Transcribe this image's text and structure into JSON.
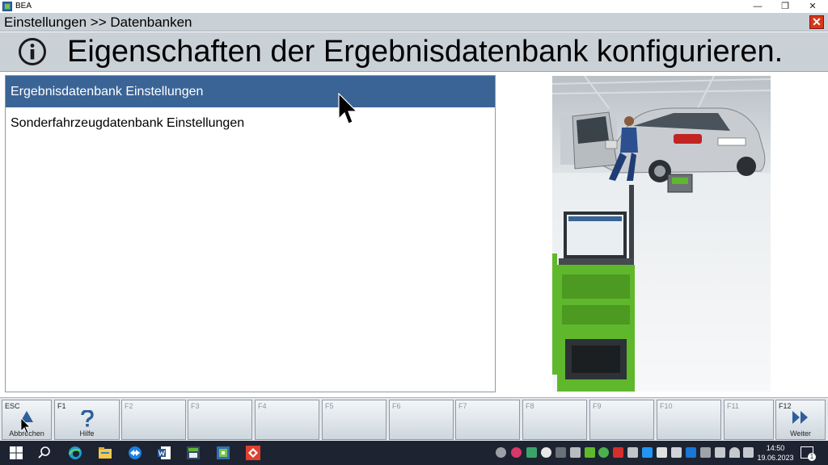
{
  "window": {
    "title": "BEA",
    "minimize_glyph": "—",
    "maximize_glyph": "❐",
    "close_glyph": "✕"
  },
  "breadcrumb": {
    "text": "Einstellungen >> Datenbanken",
    "close_glyph": "✕"
  },
  "header": {
    "icon": "info-icon",
    "title": "Eigenschaften der Ergebnisdatenbank konfigurieren."
  },
  "list": {
    "items": [
      {
        "label": "Ergebnisdatenbank Einstellungen",
        "selected": true
      },
      {
        "label": "Sonderfahrzeugdatenbank Einstellungen",
        "selected": false
      }
    ]
  },
  "fkeys": [
    {
      "key": "ESC",
      "caption": "Abbrechen",
      "icon": "up-triangle-icon",
      "enabled": true
    },
    {
      "key": "F1",
      "caption": "Hilfe",
      "icon": "question-icon",
      "enabled": true
    },
    {
      "key": "F2",
      "caption": "",
      "enabled": false
    },
    {
      "key": "F3",
      "caption": "",
      "enabled": false
    },
    {
      "key": "F4",
      "caption": "",
      "enabled": false
    },
    {
      "key": "F5",
      "caption": "",
      "enabled": false
    },
    {
      "key": "F6",
      "caption": "",
      "enabled": false
    },
    {
      "key": "F7",
      "caption": "",
      "enabled": false
    },
    {
      "key": "F8",
      "caption": "",
      "enabled": false
    },
    {
      "key": "F9",
      "caption": "",
      "enabled": false
    },
    {
      "key": "F10",
      "caption": "",
      "enabled": false
    },
    {
      "key": "F11",
      "caption": "",
      "enabled": false
    },
    {
      "key": "F12",
      "caption": "Weiter",
      "icon": "double-chevron-right-icon",
      "enabled": true
    }
  ],
  "taskbar": {
    "time": "14:50",
    "date": "19.06.2023",
    "notification_count": "1"
  },
  "colors": {
    "selection": "#3a6496",
    "header_bg": "#c9d0d6",
    "close_red": "#d8361b",
    "bosch_green": "#5fb82c",
    "taskbar": "#1d2331"
  }
}
